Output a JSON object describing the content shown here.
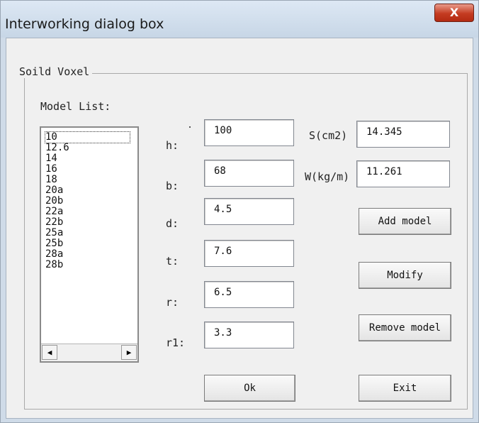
{
  "window": {
    "title": "Interworking dialog box",
    "close_label": "X"
  },
  "group": {
    "label": "Soild Voxel"
  },
  "model_list": {
    "label": "Model List:",
    "items": [
      "10",
      "12.6",
      "14",
      "16",
      "18",
      "20a",
      "20b",
      "22a",
      "22b",
      "25a",
      "25b",
      "28a",
      "28b"
    ],
    "selected": "10",
    "scroll_left": "◀",
    "scroll_right": "▶"
  },
  "fields": {
    "h": {
      "label": "h:",
      "value": "100"
    },
    "b": {
      "label": "b:",
      "value": "68"
    },
    "d": {
      "label": "d:",
      "value": "4.5"
    },
    "t": {
      "label": "t:",
      "value": "7.6"
    },
    "r": {
      "label": "r:",
      "value": "6.5"
    },
    "r1": {
      "label": "r1:",
      "value": "3.3"
    },
    "s": {
      "label": "S(cm2)",
      "value": "14.345"
    },
    "w": {
      "label": "W(kg/m)",
      "value": "11.261"
    }
  },
  "buttons": {
    "add_model": "Add model",
    "modify": "Modify",
    "remove_model": "Remove model",
    "ok": "Ok",
    "exit": "Exit"
  }
}
